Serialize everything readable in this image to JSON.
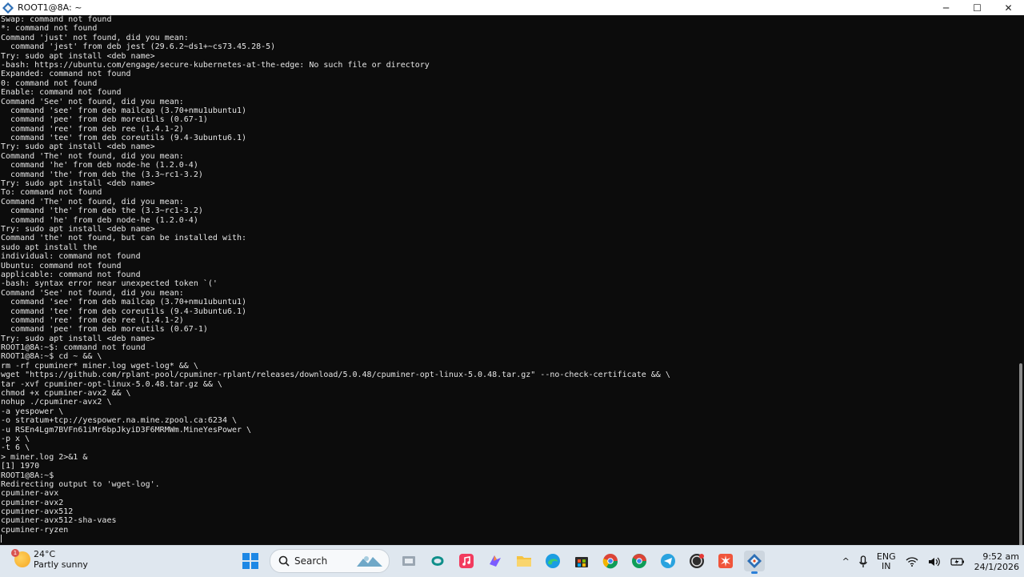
{
  "window": {
    "title": "ROOT1@8A: ~",
    "controls": {
      "minimize": "─",
      "maximize": "☐",
      "close": "✕"
    }
  },
  "terminal": {
    "lines": [
      "Swap: command not found",
      "*: command not found",
      "Command 'just' not found, did you mean:",
      "  command 'jest' from deb jest (29.6.2~ds1+~cs73.45.28-5)",
      "Try: sudo apt install <deb name>",
      "-bash: https://ubuntu.com/engage/secure-kubernetes-at-the-edge: No such file or directory",
      "Expanded: command not found",
      "0: command not found",
      "Enable: command not found",
      "Command 'See' not found, did you mean:",
      "  command 'see' from deb mailcap (3.70+nmu1ubuntu1)",
      "  command 'pee' from deb moreutils (0.67-1)",
      "  command 'ree' from deb ree (1.4.1-2)",
      "  command 'tee' from deb coreutils (9.4-3ubuntu6.1)",
      "Try: sudo apt install <deb name>",
      "Command 'The' not found, did you mean:",
      "  command 'he' from deb node-he (1.2.0-4)",
      "  command 'the' from deb the (3.3~rc1-3.2)",
      "Try: sudo apt install <deb name>",
      "To: command not found",
      "Command 'The' not found, did you mean:",
      "  command 'the' from deb the (3.3~rc1-3.2)",
      "  command 'he' from deb node-he (1.2.0-4)",
      "Try: sudo apt install <deb name>",
      "Command 'the' not found, but can be installed with:",
      "sudo apt install the",
      "individual: command not found",
      "Ubuntu: command not found",
      "applicable: command not found",
      "-bash: syntax error near unexpected token `('",
      "Command 'See' not found, did you mean:",
      "  command 'see' from deb mailcap (3.70+nmu1ubuntu1)",
      "  command 'tee' from deb coreutils (9.4-3ubuntu6.1)",
      "  command 'ree' from deb ree (1.4.1-2)",
      "  command 'pee' from deb moreutils (0.67-1)",
      "Try: sudo apt install <deb name>",
      "ROOT1@8A:~$: command not found",
      "ROOT1@8A:~$ cd ~ && \\",
      "rm -rf cpuminer* miner.log wget-log* && \\",
      "wget \"https://github.com/rplant-pool/cpuminer-rplant/releases/download/5.0.48/cpuminer-opt-linux-5.0.48.tar.gz\" --no-check-certificate && \\",
      "tar -xvf cpuminer-opt-linux-5.0.48.tar.gz && \\",
      "chmod +x cpuminer-avx2 && \\",
      "nohup ./cpuminer-avx2 \\",
      "-a yespower \\",
      "-o stratum+tcp://yespower.na.mine.zpool.ca:6234 \\",
      "-u RSEn4Lgm7BVFn61iMr6bpJkyiD3F6MRMWm.MineYesPower \\",
      "-p x \\",
      "-t 6 \\",
      "> miner.log 2>&1 &",
      "[1] 1970",
      "ROOT1@8A:~$",
      "Redirecting output to 'wget-log'.",
      "cpuminer-avx",
      "cpuminer-avx2",
      "cpuminer-avx512",
      "cpuminer-avx512-sha-vaes",
      "cpuminer-ryzen"
    ]
  },
  "taskbar": {
    "weather": {
      "badge": "1",
      "temp": "24°C",
      "desc": "Partly sunny"
    },
    "search_label": "Search",
    "tray": {
      "chevron": "^",
      "lang_top": "ENG",
      "lang_bottom": "IN",
      "time": "9:52 am",
      "date": "24/1/2026"
    }
  },
  "colors": {
    "terminal_bg": "#0c0c0c",
    "terminal_fg": "#e6e6e6",
    "taskbar_bg": "#dfe7ef",
    "accent": "#2b7fd8"
  }
}
